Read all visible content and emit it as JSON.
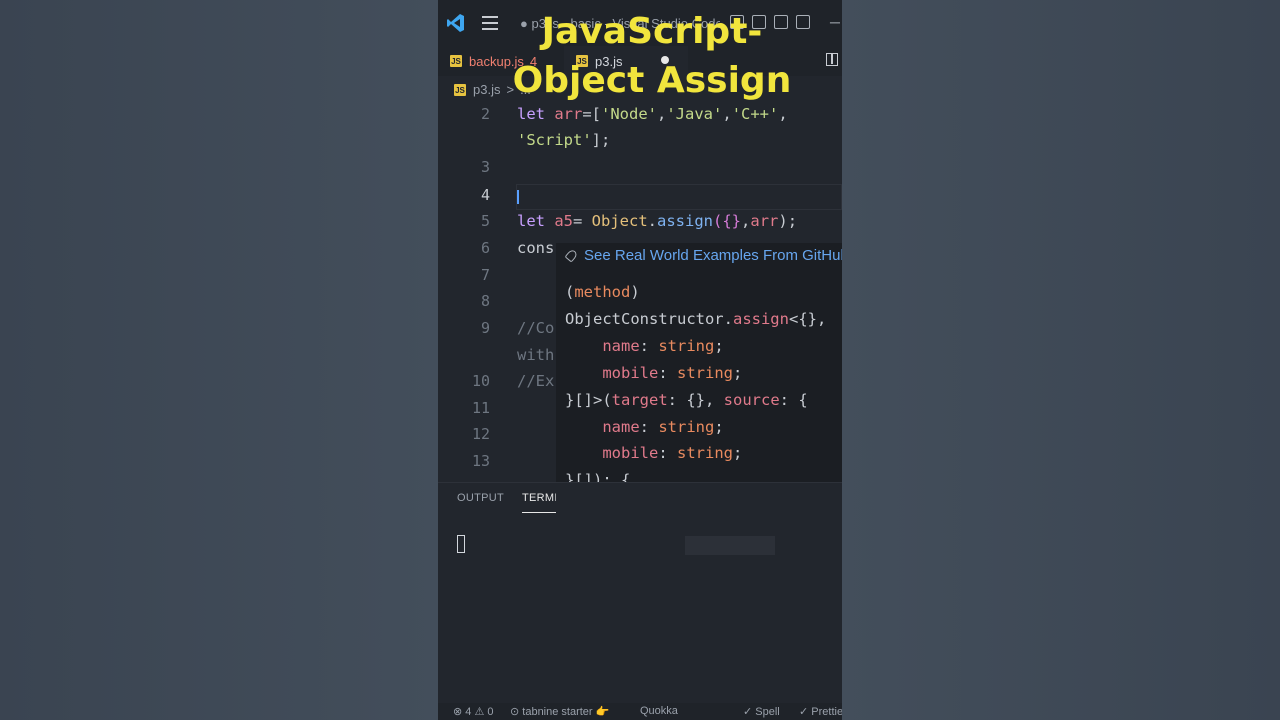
{
  "overlay": {
    "line1": "JavaScript-",
    "line2": "Object Assign"
  },
  "titlebar": {
    "title": "● p3.js - basic - Visual Studio Code",
    "minimize": "─"
  },
  "tabs": [
    {
      "badge": "JS",
      "label": "backup.js",
      "problems": "4"
    },
    {
      "badge": "JS",
      "label": "p3.js"
    }
  ],
  "breadcrumb": {
    "badge": "JS",
    "file": "p3.js",
    "sep": ">",
    "more": "..."
  },
  "lines": [
    "2",
    "",
    "3",
    "4",
    "5",
    "6",
    "7",
    "8",
    "9",
    "",
    "10",
    "11",
    "12",
    "13"
  ],
  "code": {
    "l2_let": "let ",
    "l2_arr": "arr",
    "l2_eq": "=[",
    "l2_s1": "'Node'",
    "l2_c1": ",",
    "l2_s2": "'Java'",
    "l2_c2": ",",
    "l2_s3": "'C++'",
    "l2_c3": ",",
    "l2b_s4": "'Script'",
    "l2b_end": "];",
    "l5_let": "let ",
    "l5_a5": "a5",
    "l5_eq": "= ",
    "l5_obj": "Object",
    "l5_dot": ".",
    "l5_fn": "assign",
    "l5_open": "({}",
    "l5_comma": ",",
    "l5_arr": "arr",
    "l5_close": ");",
    "l6": "cons",
    "l9": "//Co",
    "l9b": "with",
    "l10": "//Ex"
  },
  "hover": {
    "header": "See Real World Examples From GitHub",
    "h1a": "(",
    "h1b": "method",
    "h1c": ")",
    "h2a": "ObjectConstructor",
    "h2b": ".",
    "h2c": "assign",
    "h2d": "<{},",
    "p_name": "name",
    "p_mobile": "mobile",
    "colon": ": ",
    "t_string": "string",
    "semi": ";",
    "h5": "}[]>(",
    "h5_target": "target",
    "h5_mid": ": {}, ",
    "h5_source": "source",
    "h5_end": ": {",
    "h8": "}[]): {"
  },
  "panel": {
    "output": "OUTPUT",
    "terminal": "TERMINAL"
  },
  "statusbar": {
    "errors": "⊗ 4 ⚠ 0",
    "tabnine": "⊙ tabnine starter 👉",
    "quokka": "Quokka",
    "spell": "✓ Spell",
    "prettier": "✓ Prettier"
  },
  "colors": {
    "accent": "#f1e53d",
    "editor_bg": "#22262d",
    "page_bg": "#3f4a57"
  }
}
